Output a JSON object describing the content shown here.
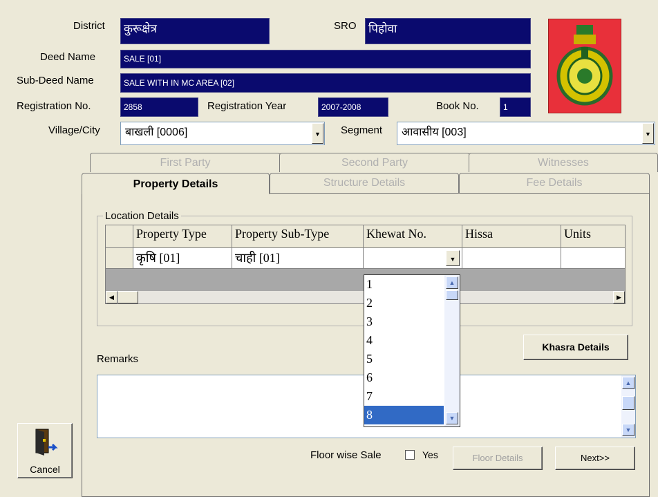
{
  "form": {
    "district_label": "District",
    "district_value": "कुरूक्षेत्र",
    "sro_label": "SRO",
    "sro_value": "पिहोवा",
    "deed_name_label": "Deed Name",
    "deed_name_value": "SALE [01]",
    "sub_deed_label": "Sub-Deed Name",
    "sub_deed_value": "SALE WITH IN MC AREA [02]",
    "reg_no_label": "Registration No.",
    "reg_no_value": "2858",
    "reg_year_label": "Registration Year",
    "reg_year_value": "2007-2008",
    "book_no_label": "Book No.",
    "book_no_value": "1",
    "village_label": "Village/City",
    "village_value": "बाखली [0006]",
    "segment_label": "Segment",
    "segment_value": "आवासीय [003]"
  },
  "tabs": {
    "row1": [
      "First Party",
      "Second Party",
      "Witnesses"
    ],
    "row2": [
      "Property Details",
      "Structure Details",
      "Fee Details"
    ]
  },
  "location": {
    "title": "Location Details",
    "columns": [
      "Property Type",
      "Property Sub-Type",
      "Khewat No.",
      "Hissa",
      "Units"
    ],
    "row": [
      "कृषि [01]",
      "चाही [01]",
      "",
      "",
      ""
    ]
  },
  "khewat_dropdown": {
    "options": [
      "1",
      "2",
      "3",
      "4",
      "5",
      "6",
      "7",
      "8"
    ],
    "selected": "8"
  },
  "buttons": {
    "khasra": "Khasra Details",
    "floor_details": "Floor Details",
    "next": "Next>>",
    "cancel": "Cancel"
  },
  "remarks_label": "Remarks",
  "floor_wise_label": "Floor wise Sale",
  "floor_wise_yes": "Yes",
  "colors": {
    "field_bg": "#0a0a6e",
    "emblem_bg": "#e8303a",
    "selection": "#316ac5",
    "window_bg": "#ece9d8"
  },
  "icons": {
    "emblem": "haryana-emblem",
    "cancel": "exit-door-icon"
  }
}
